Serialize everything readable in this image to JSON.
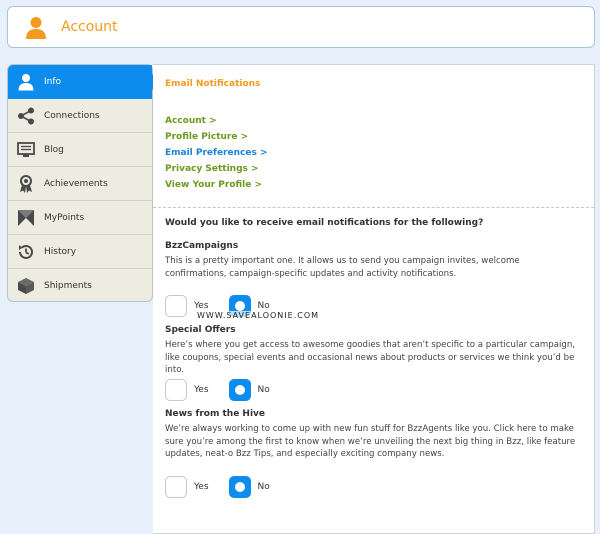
{
  "header": {
    "title": "Account",
    "icon": "person-icon",
    "accent": "#f39a1f"
  },
  "sidebar": {
    "items": [
      {
        "label": "Info",
        "icon": "person-icon",
        "active": true
      },
      {
        "label": "Connections",
        "icon": "share-icon"
      },
      {
        "label": "Blog",
        "icon": "monitor-icon"
      },
      {
        "label": "Achievements",
        "icon": "ribbon-icon"
      },
      {
        "label": "MyPoints",
        "icon": "points-icon"
      },
      {
        "label": "History",
        "icon": "history-icon"
      },
      {
        "label": "Shipments",
        "icon": "box-icon"
      }
    ],
    "active_color": "#0d8ced"
  },
  "main": {
    "section_title": "Email Notifications",
    "links": [
      {
        "label": "Account >"
      },
      {
        "label": "Profile Picture >"
      },
      {
        "label": "Email Preferences >",
        "current": true
      },
      {
        "label": "Privacy Settings >"
      },
      {
        "label": "View Your Profile >"
      }
    ],
    "question": "Would you like to receive email notifications for the following?",
    "groups": [
      {
        "title": "BzzCampaigns",
        "desc": "This is a pretty important one. It allows us to send you campaign invites, welcome confirmations, campaign-specific updates and activity notifications.",
        "yes": "Yes",
        "no": "No",
        "selected": "No"
      },
      {
        "title": "Special Offers",
        "desc": "Here’s where you get access to awesome goodies that aren’t specific to a particular campaign, like coupons, special events and occasional news about products or services we think you’d be into.",
        "yes": "Yes",
        "no": "No",
        "selected": "No"
      },
      {
        "title": "News from the Hive",
        "desc": "We’re always working to come up with new fun stuff for BzzAgents like you. Click here to make sure you’re among the first to know when we’re unveiling the next big thing in Bzz, like feature updates, neat-o Bzz Tips, and especially exciting company news.",
        "yes": "Yes",
        "no": "No",
        "selected": "No"
      }
    ]
  },
  "watermark": "WWW.SAVEALOONIE.COM"
}
